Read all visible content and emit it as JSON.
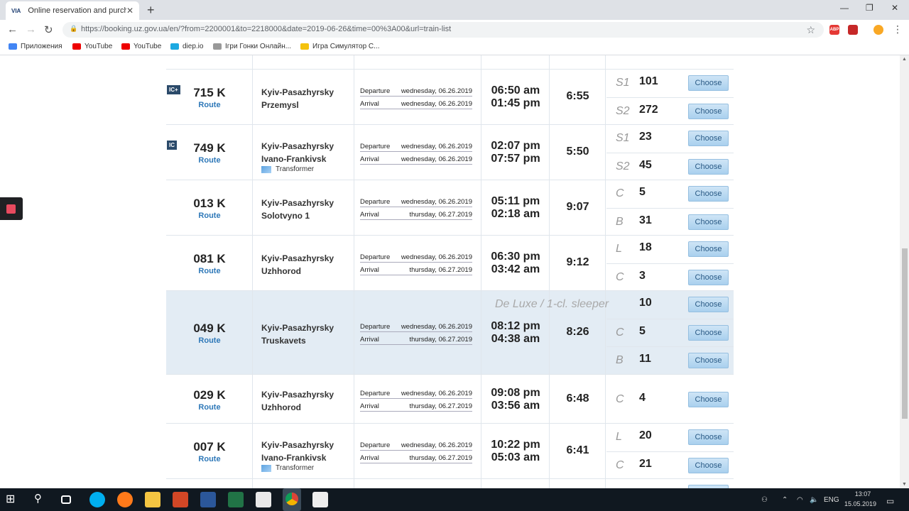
{
  "browser": {
    "tab_title": "Online reservation and purchase",
    "tab_favicon": "VIA",
    "url": "https://booking.uz.gov.ua/en/?from=2200001&to=2218000&date=2019-06-26&time=00%3A00&url=train-list"
  },
  "bookmarks": [
    {
      "label": "Приложения",
      "icon": "apps-icon",
      "color": "#4285f4"
    },
    {
      "label": "YouTube",
      "icon": "youtube-icon",
      "color": "#e00"
    },
    {
      "label": "YouTube",
      "icon": "youtube-icon",
      "color": "#e00"
    },
    {
      "label": "diep.io",
      "icon": "diep-icon",
      "color": "#1ca9e1"
    },
    {
      "label": "Ігри Гонки Онлайн...",
      "icon": "game-icon",
      "color": "#999"
    },
    {
      "label": "Игра Симулятор С...",
      "icon": "game-icon",
      "color": "#f4c20d"
    }
  ],
  "labels": {
    "departure": "Departure",
    "arrival": "Arrival",
    "route": "Route",
    "choose": "Choose"
  },
  "tooltip": "De Luxe / 1-cl. sleeper",
  "trains": [
    {
      "badge": "IC+",
      "number": "715 K",
      "from": "Kyiv-Pasazhyrsky",
      "to": "Przemysl",
      "dep_date": "wednesday, 06.26.2019",
      "arr_date": "wednesday, 06.26.2019",
      "dep_time": "06:50 am",
      "arr_time": "01:45 pm",
      "duration": "6:55",
      "seats": [
        {
          "cls": "S1",
          "count": "101"
        },
        {
          "cls": "S2",
          "count": "272"
        }
      ]
    },
    {
      "badge": "IC",
      "number": "749 K",
      "from": "Kyiv-Pasazhyrsky",
      "to": "Ivano-Frankivsk",
      "transformer": "Transformer",
      "dep_date": "wednesday, 06.26.2019",
      "arr_date": "wednesday, 06.26.2019",
      "dep_time": "02:07 pm",
      "arr_time": "07:57 pm",
      "duration": "5:50",
      "seats": [
        {
          "cls": "S1",
          "count": "23"
        },
        {
          "cls": "S2",
          "count": "45"
        }
      ]
    },
    {
      "number": "013 K",
      "from": "Kyiv-Pasazhyrsky",
      "to": "Solotvyno 1",
      "dep_date": "wednesday, 06.26.2019",
      "arr_date": "thursday, 06.27.2019",
      "dep_time": "05:11 pm",
      "arr_time": "02:18 am",
      "duration": "9:07",
      "seats": [
        {
          "cls": "C",
          "count": "5"
        },
        {
          "cls": "B",
          "count": "31"
        }
      ]
    },
    {
      "number": "081 K",
      "from": "Kyiv-Pasazhyrsky",
      "to": "Uzhhorod",
      "dep_date": "wednesday, 06.26.2019",
      "arr_date": "thursday, 06.27.2019",
      "dep_time": "06:30 pm",
      "arr_time": "03:42 am",
      "duration": "9:12",
      "seats": [
        {
          "cls": "L",
          "count": "18"
        },
        {
          "cls": "C",
          "count": "3"
        }
      ]
    },
    {
      "number": "049 K",
      "from": "Kyiv-Pasazhyrsky",
      "to": "Truskavets",
      "dep_date": "wednesday, 06.26.2019",
      "arr_date": "thursday, 06.27.2019",
      "dep_time": "08:12 pm",
      "arr_time": "04:38 am",
      "duration": "8:26",
      "seats": [
        {
          "cls": "",
          "count": "10"
        },
        {
          "cls": "C",
          "count": "5"
        },
        {
          "cls": "B",
          "count": "11"
        }
      ]
    },
    {
      "number": "029 K",
      "from": "Kyiv-Pasazhyrsky",
      "to": "Uzhhorod",
      "dep_date": "wednesday, 06.26.2019",
      "arr_date": "thursday, 06.27.2019",
      "dep_time": "09:08 pm",
      "arr_time": "03:56 am",
      "duration": "6:48",
      "seats": [
        {
          "cls": "C",
          "count": "4"
        }
      ]
    },
    {
      "number": "007 K",
      "from": "Kyiv-Pasazhyrsky",
      "to": "Ivano-Frankivsk",
      "transformer": "Transformer",
      "dep_date": "wednesday, 06.26.2019",
      "arr_date": "thursday, 06.27.2019",
      "dep_time": "10:22 pm",
      "arr_time": "05:03 am",
      "duration": "6:41",
      "seats": [
        {
          "cls": "L",
          "count": "20"
        },
        {
          "cls": "C",
          "count": "21"
        }
      ]
    }
  ],
  "taskbar": {
    "lang": "ENG",
    "time": "13:07",
    "date": "15.05.2019"
  }
}
